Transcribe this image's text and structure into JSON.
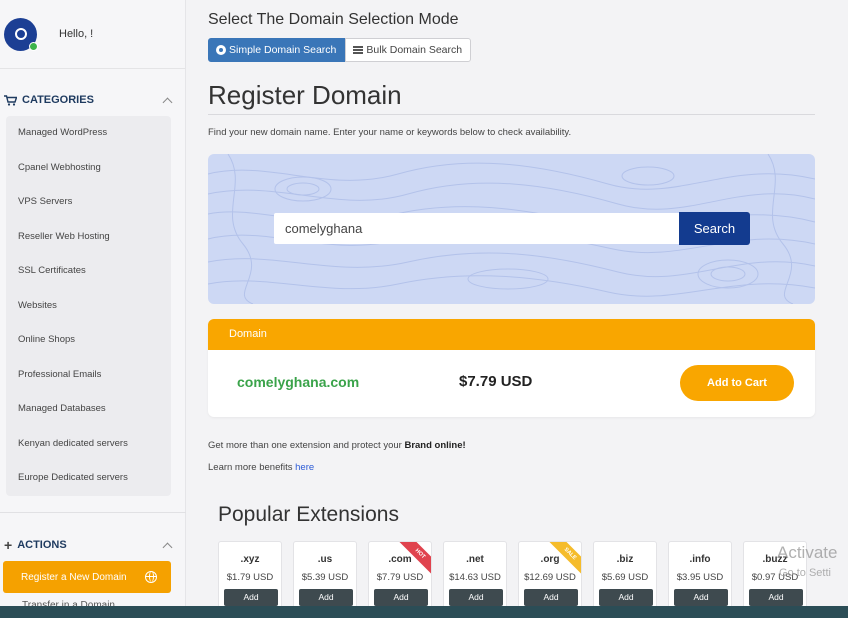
{
  "user": {
    "greeting": "Hello, !"
  },
  "sidebar": {
    "categories_title": "CATEGORIES",
    "categories": [
      "Managed WordPress",
      "Cpanel Webhosting",
      "VPS Servers",
      "Reseller Web Hosting",
      "SSL Certificates",
      "Websites",
      "Online Shops",
      "Professional Emails",
      "Managed Databases",
      "Kenyan dedicated servers",
      "Europe Dedicated servers"
    ],
    "actions_title": "ACTIONS",
    "register_new_label": "Register a New Domain",
    "next_item_label": "Transfer in a Domain"
  },
  "mode": {
    "title": "Select The Domain Selection Mode",
    "simple_label": "Simple Domain Search",
    "bulk_label": "Bulk Domain Search"
  },
  "page": {
    "title": "Register Domain",
    "subtitle": "Find your new domain name. Enter your name or keywords below to check availability."
  },
  "search": {
    "value": "comelyghana",
    "button_label": "Search"
  },
  "result": {
    "header": "Domain",
    "domain": "comelyghana.com",
    "price": "$7.79 USD",
    "add_to_cart_label": "Add to Cart"
  },
  "promo": {
    "text_before": "Get more than one extension and protect your ",
    "text_bold": "Brand online!",
    "learn_text": "Learn more benefits ",
    "learn_link": "here"
  },
  "popular": {
    "title": "Popular Extensions",
    "extensions": [
      {
        "name": ".xyz",
        "price": "$1.79 USD",
        "add": "Add"
      },
      {
        "name": ".us",
        "price": "$5.39 USD",
        "add": "Add"
      },
      {
        "name": ".com",
        "price": "$7.79 USD",
        "add": "Add",
        "ribbon": "HOT"
      },
      {
        "name": ".net",
        "price": "$14.63 USD",
        "add": "Add"
      },
      {
        "name": ".org",
        "price": "$12.69 USD",
        "add": "Add",
        "ribbon": "SALE"
      },
      {
        "name": ".biz",
        "price": "$5.69 USD",
        "add": "Add"
      },
      {
        "name": ".info",
        "price": "$3.95 USD",
        "add": "Add"
      },
      {
        "name": ".buzz",
        "price": "$0.97 USD",
        "add": "Add"
      }
    ]
  },
  "watermark": {
    "line1": "Activate",
    "line2": "Go to Setti"
  },
  "colors": {
    "accent": "#f9a600",
    "primary": "#133b8f",
    "tab_active": "#3a76b8",
    "success": "#3aa34a"
  }
}
